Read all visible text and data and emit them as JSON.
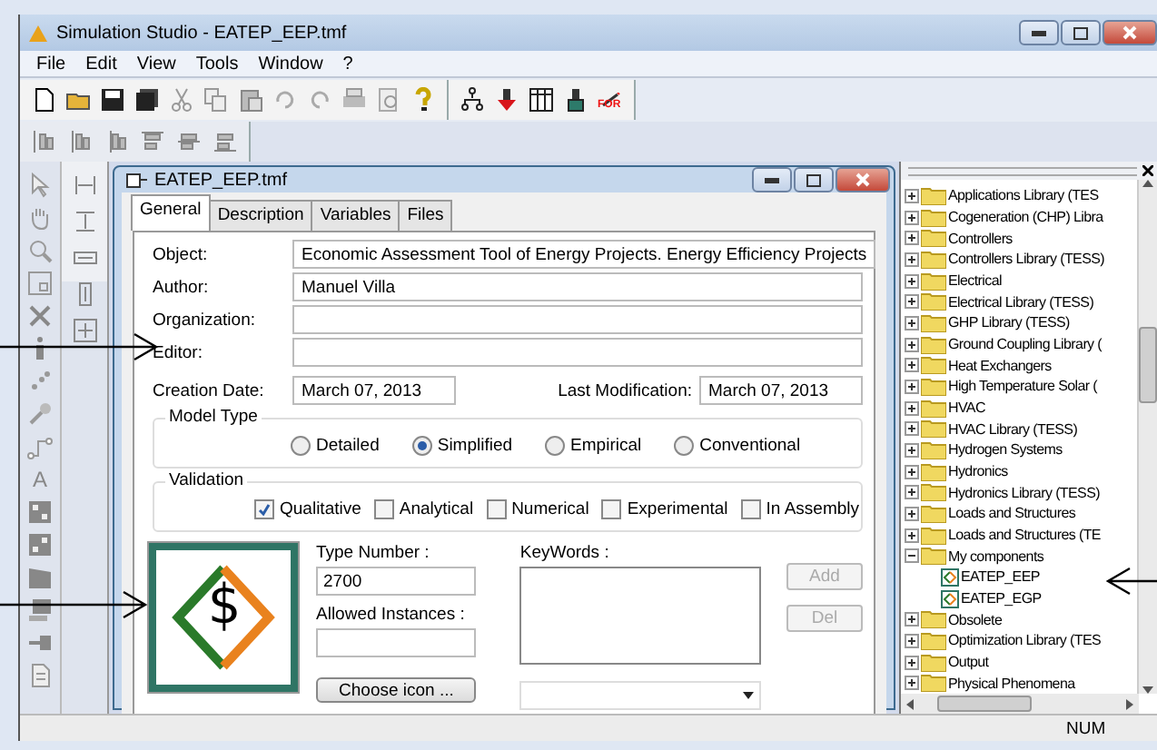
{
  "window": {
    "title": "Simulation Studio - EATEP_EEP.tmf"
  },
  "menu": [
    "File",
    "Edit",
    "View",
    "Tools",
    "Window",
    "?"
  ],
  "toolbar": {
    "for_label": "FOR"
  },
  "tools": {
    "text_tool": "A"
  },
  "dialog": {
    "title": "EATEP_EEP.tmf",
    "tabs": [
      {
        "label": "General",
        "selected": true
      },
      {
        "label": "Description",
        "selected": false
      },
      {
        "label": "Variables",
        "selected": false
      },
      {
        "label": "Files",
        "selected": false
      }
    ],
    "fields": [
      {
        "label": "Object:",
        "value": "Economic Assessment Tool of Energy Projects. Energy Efficiency Projects"
      },
      {
        "label": "Author:",
        "value": "Manuel Villa"
      },
      {
        "label": "Organization:"
      },
      {
        "label": "Editor:"
      }
    ],
    "creation_date": {
      "label": "Creation Date:",
      "value": "March 07, 2013"
    },
    "last_modification": {
      "label": "Last Modification:",
      "value": "March 07, 2013"
    },
    "model_type": {
      "title": "Model Type",
      "options": [
        {
          "label": "Detailed",
          "selected": false
        },
        {
          "label": "Simplified",
          "selected": true
        },
        {
          "label": "Empirical",
          "selected": false
        },
        {
          "label": "Conventional",
          "selected": false
        }
      ]
    },
    "validation": {
      "title": "Validation",
      "options": [
        {
          "label": "Qualitative",
          "checked": true
        },
        {
          "label": "Analytical",
          "checked": false
        },
        {
          "label": "Numerical",
          "checked": false
        },
        {
          "label": "Experimental",
          "checked": false
        },
        {
          "label": "In Assembly",
          "checked": false
        }
      ]
    },
    "icon_symbol": "$",
    "type_number": {
      "label": "Type Number :",
      "value": "2700"
    },
    "allowed_instances": {
      "label": "Allowed Instances :"
    },
    "choose_icon": "Choose icon ...",
    "keywords": {
      "label": "KeyWords :"
    },
    "buttons": [
      {
        "label": "Add",
        "disabled": true
      },
      {
        "label": "Del",
        "disabled": true
      }
    ]
  },
  "tree": {
    "items": [
      {
        "label": "Applications Library (TES",
        "expanded": false
      },
      {
        "label": "Cogeneration (CHP) Libra",
        "expanded": false
      },
      {
        "label": "Controllers",
        "expanded": false
      },
      {
        "label": "Controllers Library (TESS)",
        "expanded": false
      },
      {
        "label": "Electrical",
        "expanded": false
      },
      {
        "label": "Electrical Library (TESS)",
        "expanded": false
      },
      {
        "label": "GHP Library (TESS)",
        "expanded": false
      },
      {
        "label": "Ground Coupling Library (",
        "expanded": false
      },
      {
        "label": "Heat Exchangers",
        "expanded": false
      },
      {
        "label": "High Temperature Solar (",
        "expanded": false
      },
      {
        "label": "HVAC",
        "expanded": false
      },
      {
        "label": "HVAC Library (TESS)",
        "expanded": false
      },
      {
        "label": "Hydrogen Systems",
        "expanded": false
      },
      {
        "label": "Hydronics",
        "expanded": false
      },
      {
        "label": "Hydronics Library (TESS)",
        "expanded": false
      },
      {
        "label": "Loads and Structures",
        "expanded": false
      },
      {
        "label": "Loads and Structures (TE",
        "expanded": false
      },
      {
        "label": "My components",
        "expanded": true,
        "children": [
          {
            "label": "EATEP_EEP"
          },
          {
            "label": "EATEP_EGP"
          }
        ]
      },
      {
        "label": "Obsolete",
        "expanded": false
      },
      {
        "label": "Optimization Library (TES",
        "expanded": false
      },
      {
        "label": "Output",
        "expanded": false
      },
      {
        "label": "Physical Phenomena",
        "expanded": false
      }
    ]
  },
  "status_bar": {
    "num": "NUM"
  }
}
